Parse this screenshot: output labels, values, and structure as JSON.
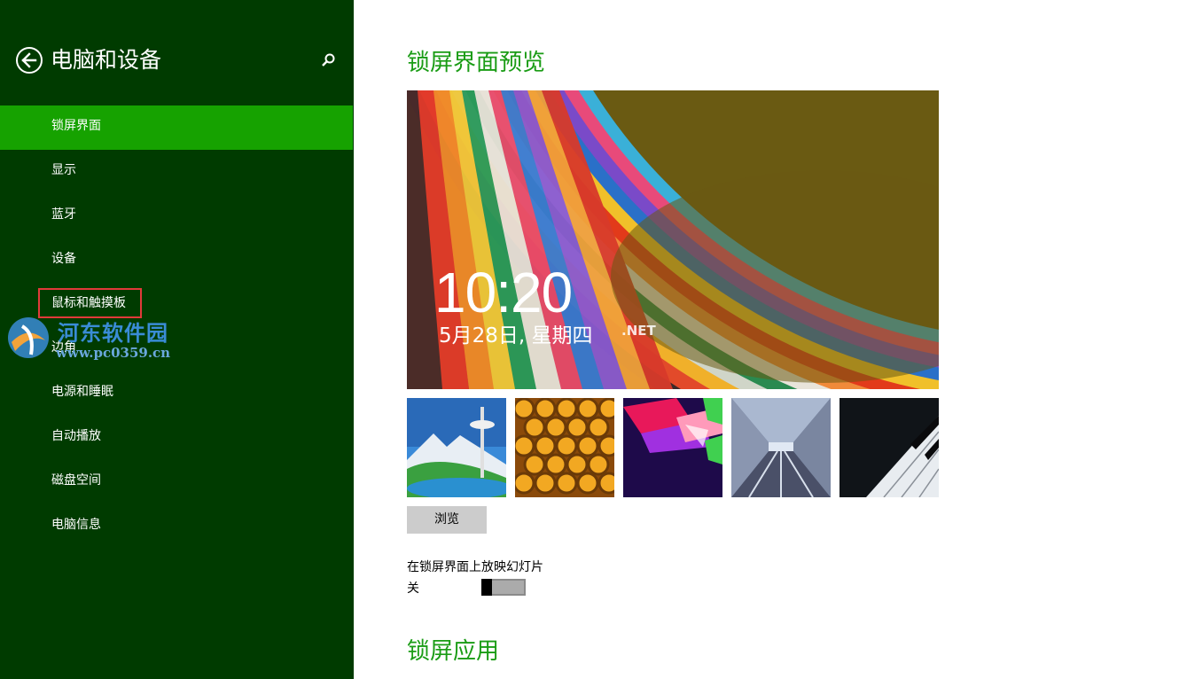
{
  "colors": {
    "sidebar_bg": "#003b00",
    "sidebar_active": "#16a200",
    "accent": "#1a9c15",
    "highlight_box": "#e23a3a"
  },
  "sidebar": {
    "back_icon": "back-arrow-icon",
    "title": "电脑和设备",
    "search_icon": "search-icon",
    "items": [
      {
        "label": "锁屏界面",
        "active": true
      },
      {
        "label": "显示"
      },
      {
        "label": "蓝牙"
      },
      {
        "label": "设备"
      },
      {
        "label": "鼠标和触摸板",
        "highlighted": true
      },
      {
        "label": "边角"
      },
      {
        "label": "电源和睡眠"
      },
      {
        "label": "自动播放"
      },
      {
        "label": "磁盘空间"
      },
      {
        "label": "电脑信息"
      }
    ]
  },
  "watermark": {
    "name": "河东软件园",
    "url": "www.pc0359.cn"
  },
  "main": {
    "preview_title": "锁屏界面预览",
    "preview": {
      "time": "10:20",
      "date": "5月28日, 星期四",
      "overlay_text": ".NET"
    },
    "thumbnails": [
      {
        "name": "space-needle-thumbnail"
      },
      {
        "name": "honeycomb-thumbnail"
      },
      {
        "name": "geometric-shapes-thumbnail"
      },
      {
        "name": "tunnel-thumbnail"
      },
      {
        "name": "piano-keys-thumbnail"
      }
    ],
    "browse_label": "浏览",
    "slideshow_label": "在锁屏界面上放映幻灯片",
    "slideshow_state": "关",
    "slideshow_on": false,
    "apps_title": "锁屏应用"
  }
}
